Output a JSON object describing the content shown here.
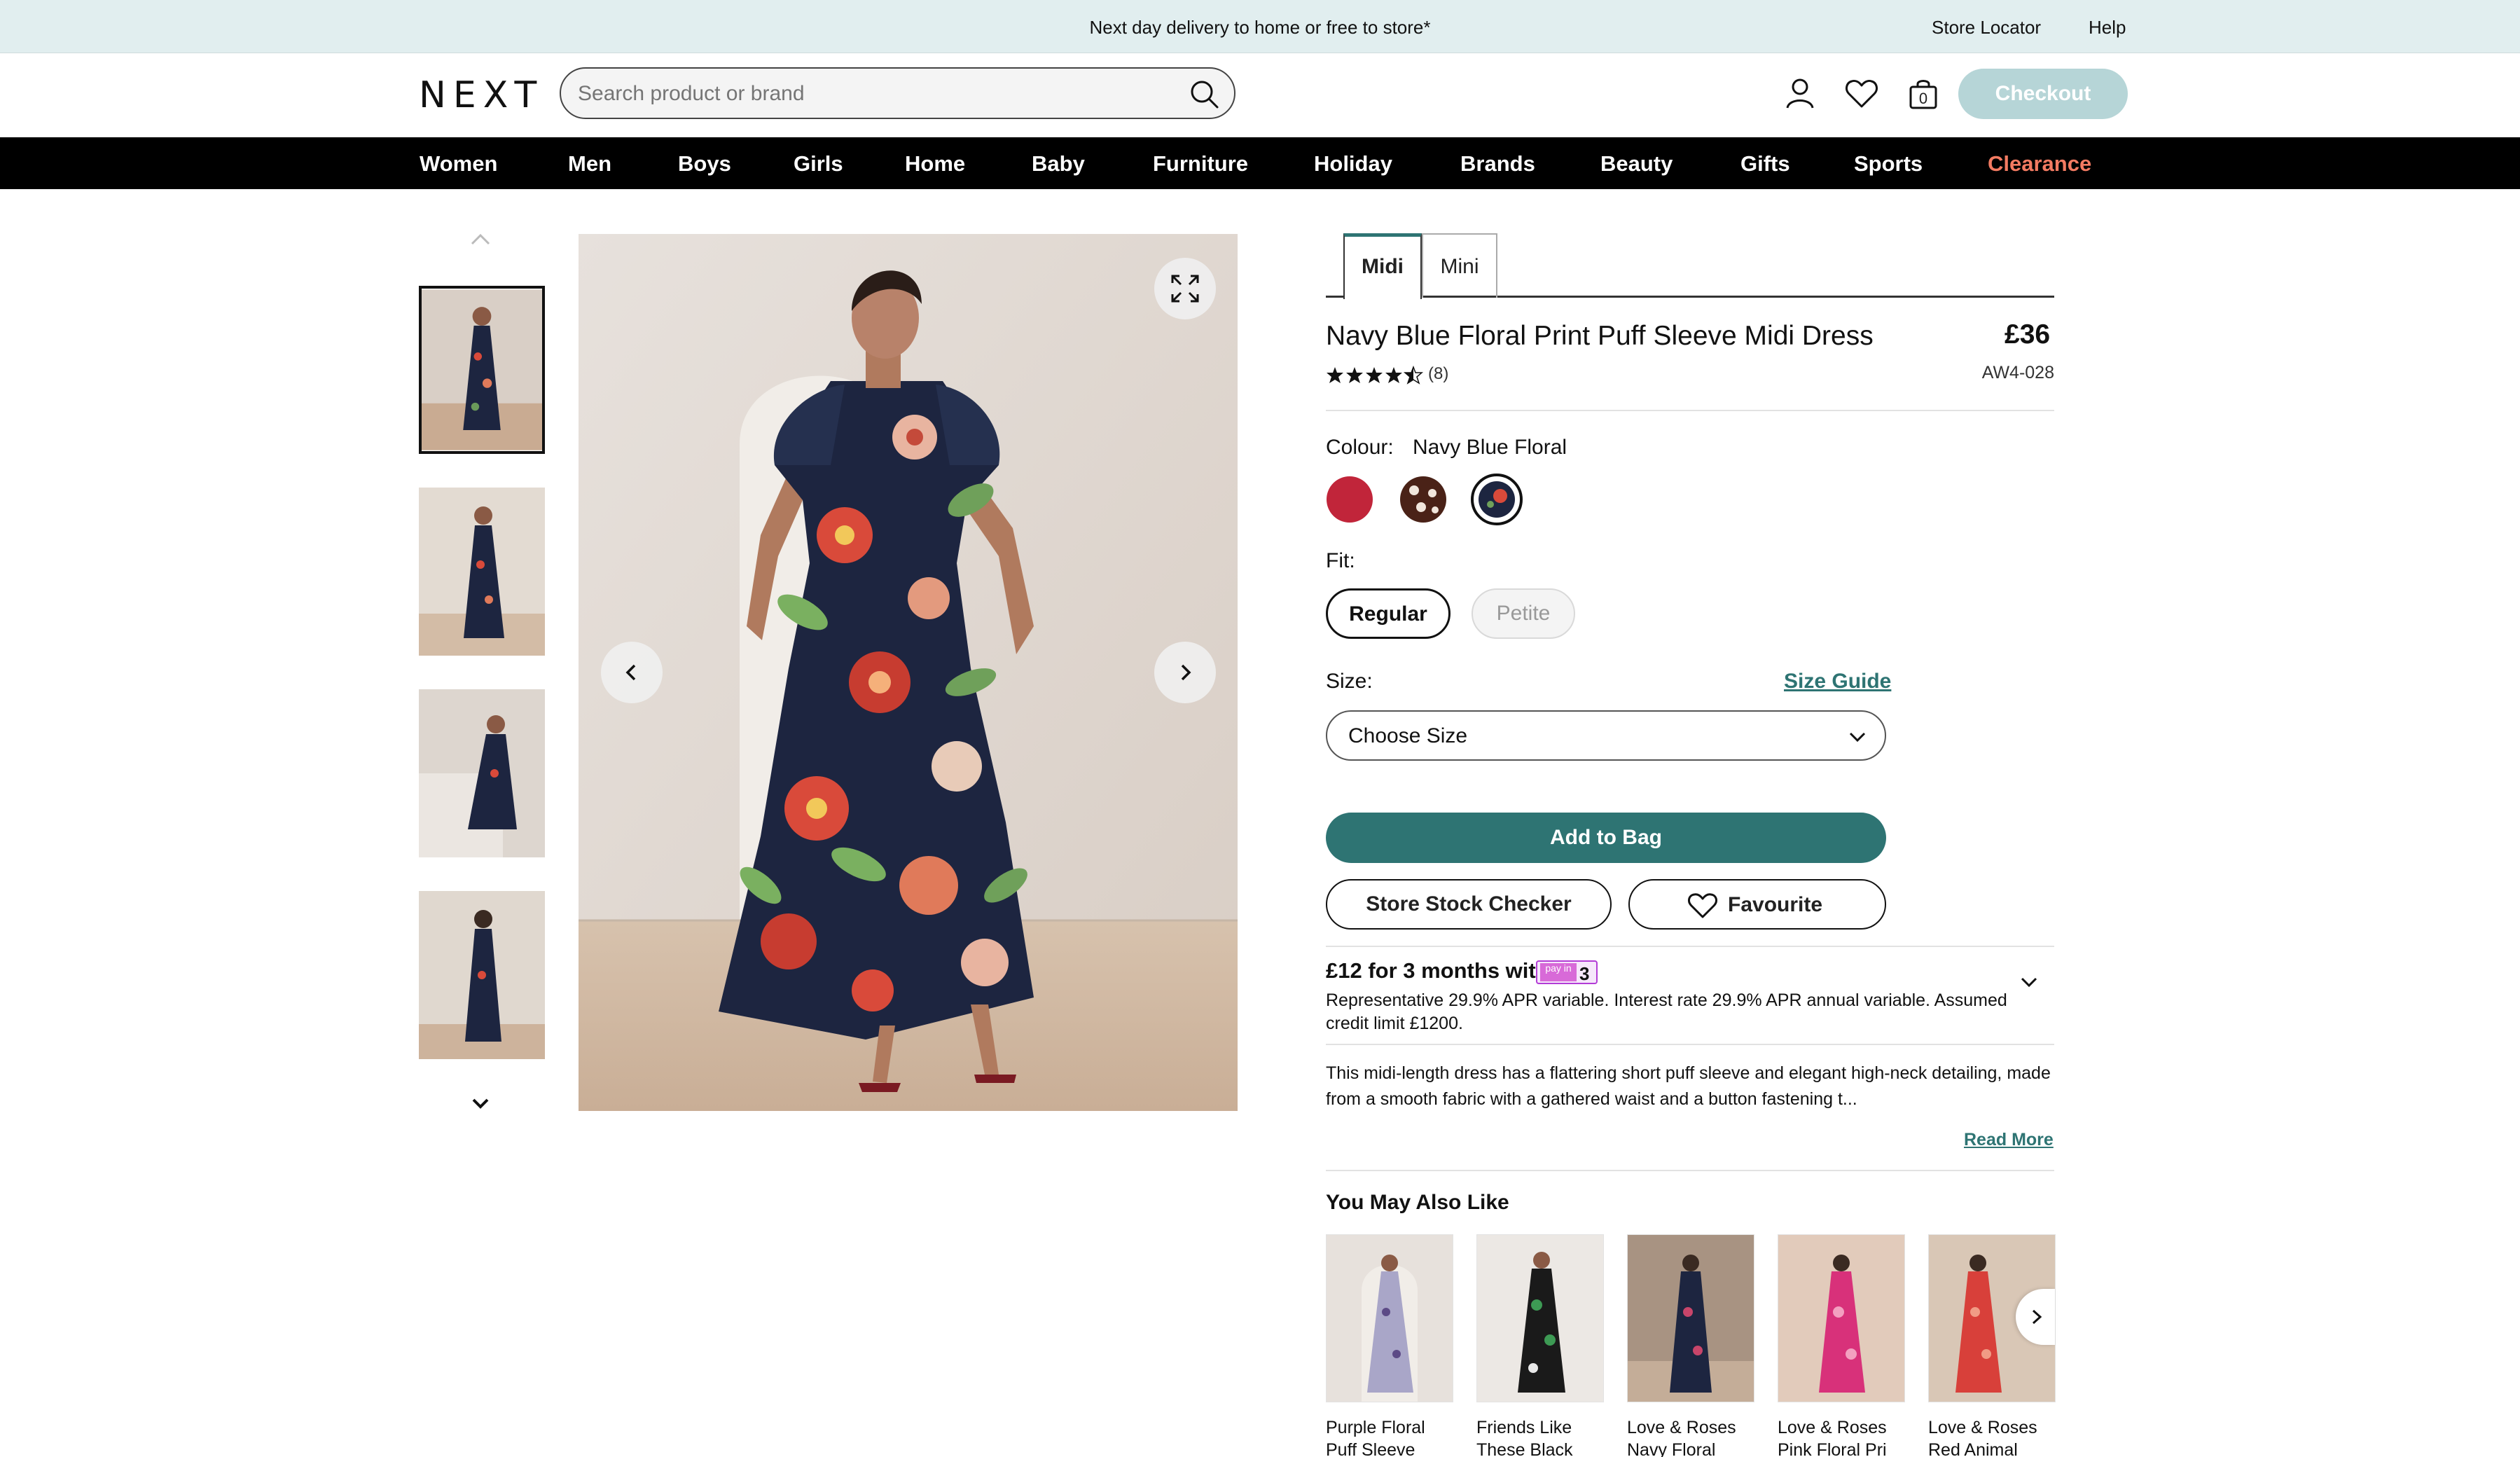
{
  "promo": {
    "message": "Next day delivery to home or free to store*",
    "store_locator": "Store Locator",
    "help": "Help"
  },
  "header": {
    "logo": "NEXT",
    "search_placeholder": "Search product or brand",
    "bag_count": "0",
    "checkout": "Checkout"
  },
  "nav": {
    "items": [
      "Women",
      "Men",
      "Boys",
      "Girls",
      "Home",
      "Baby",
      "Furniture",
      "Holiday",
      "Brands",
      "Beauty",
      "Gifts",
      "Sports",
      "Clearance"
    ]
  },
  "product": {
    "tabs": [
      "Midi",
      "Mini"
    ],
    "title": "Navy Blue Floral Print Puff Sleeve Midi Dress",
    "price": "£36",
    "code": "AW4-028",
    "rating": 4.5,
    "review_count": "(8)",
    "colour_label": "Colour:",
    "colour_value": "Navy Blue Floral",
    "swatches": [
      {
        "name": "red",
        "color": "#c1253a"
      },
      {
        "name": "brown-spot",
        "color": "#4a2217"
      },
      {
        "name": "navy-floral",
        "color": "#1d2540"
      }
    ],
    "fit_label": "Fit:",
    "fit_options": [
      "Regular",
      "Petite"
    ],
    "size_label": "Size:",
    "size_guide": "Size Guide",
    "size_select": "Choose Size",
    "add_to_bag": "Add to Bag",
    "store_stock": "Store Stock Checker",
    "favourite": "Favourite",
    "payin_text": "£12 for 3 months with",
    "payin_badge_small": "pay in",
    "payin_badge_num": "3",
    "representative": "Representative 29.9% APR variable. Interest rate 29.9% APR annual variable. Assumed credit limit £1200.",
    "description": "This midi-length dress has a flattering short puff sleeve and elegant high-neck detailing, made from a smooth fabric with a gathered waist and a button fastening t...",
    "read_more": "Read More"
  },
  "recommendations": {
    "heading": "You May Also Like",
    "items": [
      {
        "name": "Purple Floral Puff Sleeve",
        "dress": "#a9a6c8",
        "accent": "#5c4a86"
      },
      {
        "name": "Friends Like These Black",
        "dress": "#1a1a1a",
        "accent": "#3d9a54"
      },
      {
        "name": "Love & Roses Navy Floral",
        "dress": "#1d2540",
        "accent": "#c8456a"
      },
      {
        "name": "Love & Roses Pink Floral Pri",
        "dress": "#d8317a",
        "accent": "#f3a0c0"
      },
      {
        "name": "Love & Roses Red Animal",
        "dress": "#d8403a",
        "accent": "#f19b85"
      }
    ]
  },
  "colors": {
    "teal": "#2e7473",
    "promo_bg": "#e1eeef",
    "checkout_bg": "#b6d5d7",
    "clearance": "#f37b62"
  }
}
